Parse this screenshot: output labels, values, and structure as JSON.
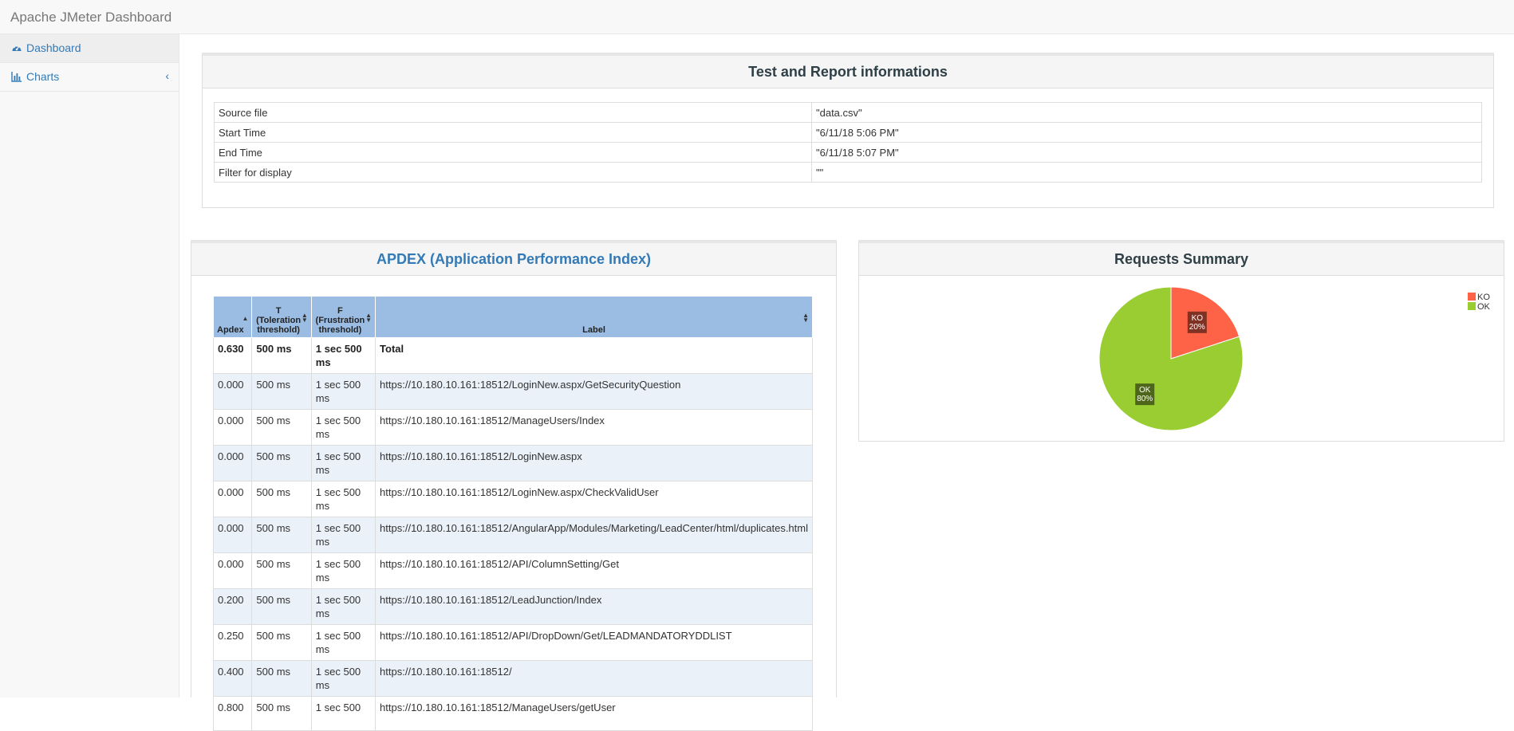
{
  "app": {
    "title": "Apache JMeter Dashboard"
  },
  "sidebar": {
    "items": [
      {
        "label": "Dashboard",
        "icon": "dashboard-icon"
      },
      {
        "label": "Charts",
        "icon": "bar-chart-icon",
        "chevron": "‹"
      }
    ]
  },
  "info": {
    "title": "Test and Report informations",
    "rows": [
      {
        "key": "Source file",
        "value": "\"data.csv\""
      },
      {
        "key": "Start Time",
        "value": "\"6/11/18 5:06 PM\""
      },
      {
        "key": "End Time",
        "value": "\"6/11/18 5:07 PM\""
      },
      {
        "key": "Filter for display",
        "value": "\"\""
      }
    ]
  },
  "apdex": {
    "title": "APDEX (Application Performance Index)",
    "headers": {
      "apdex": "Apdex",
      "t": "T (Toleration threshold)",
      "f": "F (Frustration threshold)",
      "label": "Label"
    },
    "rows": [
      {
        "apdex": "0.630",
        "t": "500 ms",
        "f": "1 sec 500 ms",
        "label": "Total"
      },
      {
        "apdex": "0.000",
        "t": "500 ms",
        "f": "1 sec 500 ms",
        "label": "https://10.180.10.161:18512/LoginNew.aspx/GetSecurityQuestion"
      },
      {
        "apdex": "0.000",
        "t": "500 ms",
        "f": "1 sec 500 ms",
        "label": "https://10.180.10.161:18512/ManageUsers/Index"
      },
      {
        "apdex": "0.000",
        "t": "500 ms",
        "f": "1 sec 500 ms",
        "label": "https://10.180.10.161:18512/LoginNew.aspx"
      },
      {
        "apdex": "0.000",
        "t": "500 ms",
        "f": "1 sec 500 ms",
        "label": "https://10.180.10.161:18512/LoginNew.aspx/CheckValidUser"
      },
      {
        "apdex": "0.000",
        "t": "500 ms",
        "f": "1 sec 500 ms",
        "label": "https://10.180.10.161:18512/AngularApp/Modules/Marketing/LeadCenter/html/duplicates.html"
      },
      {
        "apdex": "0.000",
        "t": "500 ms",
        "f": "1 sec 500 ms",
        "label": "https://10.180.10.161:18512/API/ColumnSetting/Get"
      },
      {
        "apdex": "0.200",
        "t": "500 ms",
        "f": "1 sec 500 ms",
        "label": "https://10.180.10.161:18512/LeadJunction/Index"
      },
      {
        "apdex": "0.250",
        "t": "500 ms",
        "f": "1 sec 500 ms",
        "label": "https://10.180.10.161:18512/API/DropDown/Get/LEADMANDATORYDDLIST"
      },
      {
        "apdex": "0.400",
        "t": "500 ms",
        "f": "1 sec 500 ms",
        "label": "https://10.180.10.161:18512/"
      },
      {
        "apdex": "0.800",
        "t": "500 ms",
        "f": "1 sec 500",
        "label": "https://10.180.10.161:18512/ManageUsers/getUser"
      }
    ]
  },
  "summary": {
    "title": "Requests Summary",
    "chart_data": {
      "type": "pie",
      "title": "Requests Summary",
      "series": [
        {
          "name": "KO",
          "percent": 20,
          "label": "KO\n20%",
          "color": "#ff6347"
        },
        {
          "name": "OK",
          "percent": 80,
          "label": "OK\n80%",
          "color": "#9acd32"
        }
      ],
      "legend": "top-right"
    }
  }
}
